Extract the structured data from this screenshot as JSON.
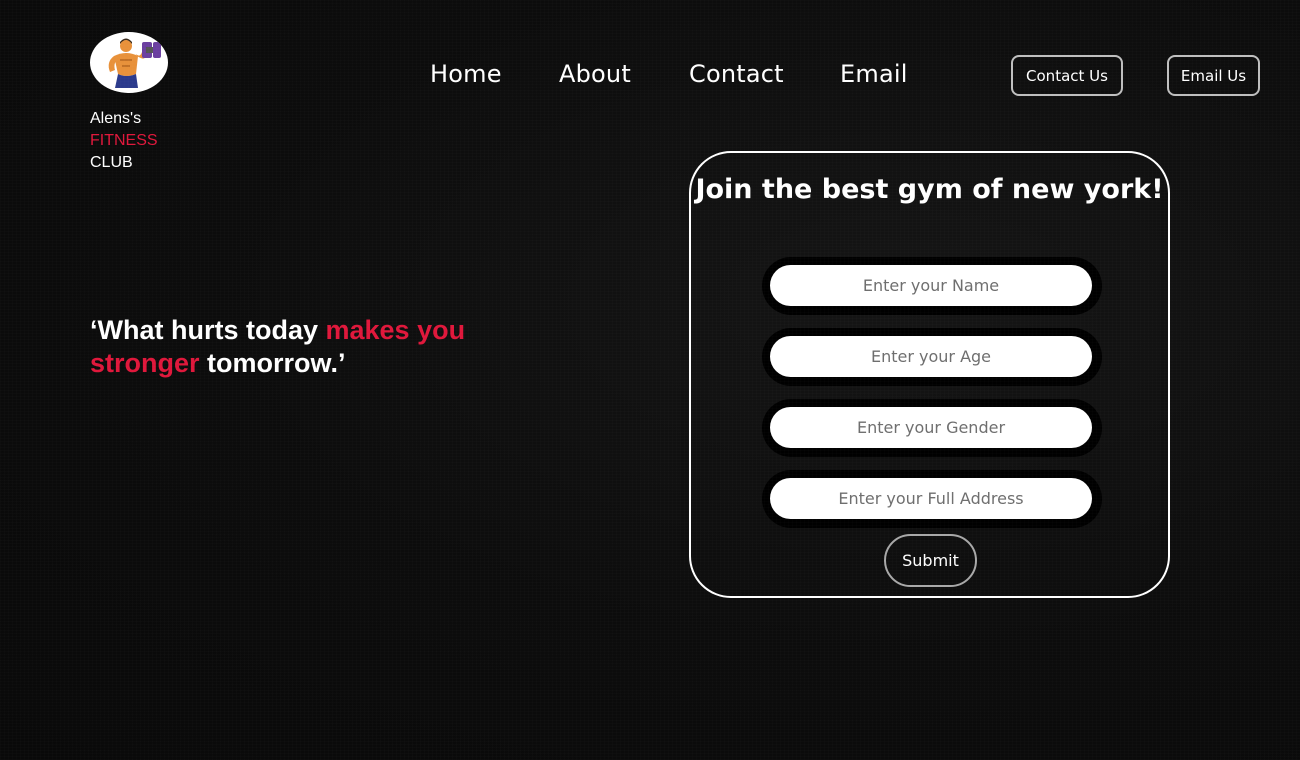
{
  "brand": {
    "line1": "Alens's",
    "line2": "FITNESS",
    "line3": "CLUB",
    "logo_icon": "bodybuilder-dumbbell-icon"
  },
  "nav": {
    "items": [
      {
        "label": "Home"
      },
      {
        "label": "About"
      },
      {
        "label": "Contact"
      },
      {
        "label": "Email"
      }
    ],
    "contact_button": "Contact Us",
    "email_button": "Email Us"
  },
  "quote": {
    "part1": "‘What hurts today ",
    "part2": "makes you stronger",
    "part3": " tomorrow.’"
  },
  "form": {
    "title": "Join the best gym of new york!",
    "fields": [
      {
        "placeholder": "Enter your Name",
        "value": ""
      },
      {
        "placeholder": "Enter your Age",
        "value": ""
      },
      {
        "placeholder": "Enter your Gender",
        "value": ""
      },
      {
        "placeholder": "Enter your Full Address",
        "value": ""
      }
    ],
    "submit_label": "Submit"
  },
  "colors": {
    "background": "#0b0b0b",
    "accent_red": "#e0173b",
    "text": "#ffffff"
  }
}
